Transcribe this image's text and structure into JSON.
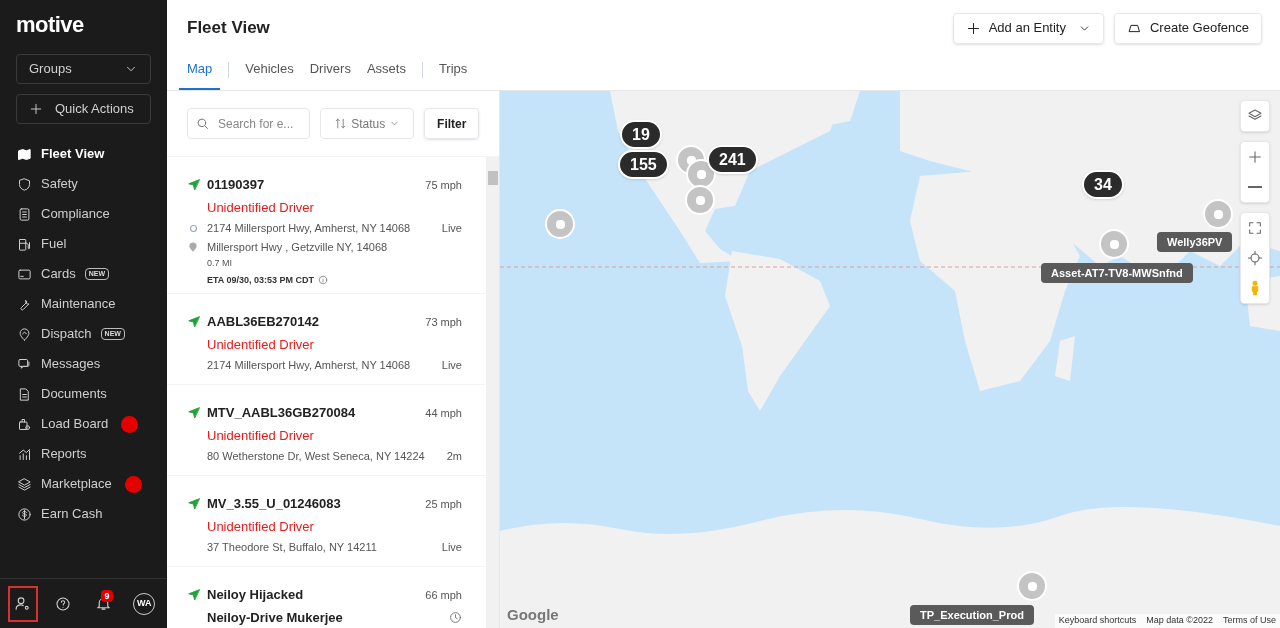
{
  "sidebar": {
    "logo": "motive",
    "groups_select": "Groups",
    "quick_actions": "Quick Actions",
    "items": [
      {
        "label": "Fleet View",
        "selected": true
      },
      {
        "label": "Safety",
        "selected": false
      },
      {
        "label": "Compliance",
        "selected": false
      },
      {
        "label": "Fuel",
        "selected": false
      },
      {
        "label": "Cards",
        "selected": false,
        "badge": "NEW"
      },
      {
        "label": "Maintenance",
        "selected": false
      },
      {
        "label": "Dispatch",
        "selected": false,
        "badge": "NEW"
      },
      {
        "label": "Messages",
        "selected": false
      },
      {
        "label": "Documents",
        "selected": false
      },
      {
        "label": "Load Board",
        "selected": false,
        "alert": true
      },
      {
        "label": "Reports",
        "selected": false
      },
      {
        "label": "Marketplace",
        "selected": false,
        "alert": true
      },
      {
        "label": "Earn Cash",
        "selected": false
      }
    ],
    "footer": [
      {
        "kind": "user-settings",
        "highlighted": true
      },
      {
        "kind": "help",
        "highlighted": false
      },
      {
        "kind": "bell",
        "highlighted": false,
        "count": "9"
      },
      {
        "kind": "avatar",
        "highlighted": false,
        "initials": "WA"
      }
    ]
  },
  "header": {
    "title": "Fleet View",
    "add_entity": "Add an Entity",
    "create_geofence": "Create Geofence",
    "tabs": [
      {
        "label": "Map",
        "selected": true
      },
      {
        "label": "Vehicles",
        "selected": false
      },
      {
        "label": "Drivers",
        "selected": false
      },
      {
        "label": "Assets",
        "selected": false
      },
      {
        "label": "Trips",
        "selected": false
      }
    ]
  },
  "list": {
    "search_placeholder": "Search for e...",
    "sort": "Status",
    "filter": "Filter",
    "vehicles": [
      {
        "name": "01190397",
        "speed": "75 mph",
        "driver": "Unidentified Driver",
        "unidentified": true,
        "address": "2174 Millersport Hwy, Amherst, NY 14068",
        "status": "Live",
        "destination": "Millersport Hwy , Getzville NY, 14068",
        "distance": "0.7 MI",
        "eta": "ETA 09/30, 03:53 PM CDT"
      },
      {
        "name": "AABL36EB270142",
        "speed": "73 mph",
        "driver": "Unidentified Driver",
        "unidentified": true,
        "address": "2174 Millersport Hwy, Amherst, NY 14068",
        "status": "Live"
      },
      {
        "name": "MTV_AABL36GB270084",
        "speed": "44 mph",
        "driver": "Unidentified Driver",
        "unidentified": true,
        "address": "80 Wetherstone Dr, West Seneca, NY 14224",
        "status": "2m"
      },
      {
        "name": "MV_3.55_U_01246083",
        "speed": "25 mph",
        "driver": "Unidentified Driver",
        "unidentified": true,
        "address": "37 Theodore St, Buffalo, NY 14211",
        "status": "Live"
      },
      {
        "name": "Neiloy Hijacked",
        "speed": "66 mph",
        "driver": "Neiloy-Drive Mukerjee",
        "unidentified": false,
        "clock": true
      }
    ]
  },
  "map": {
    "clusters": [
      "19",
      "155",
      "241",
      "34"
    ],
    "asset_labels": [
      "Asset-AT7-TV8-MWSnfnd",
      "Welly36PV",
      "TP_Execution_Prod"
    ],
    "logo": "Google",
    "attribution": [
      "Keyboard shortcuts",
      "Map data ©2022",
      "Terms of Use"
    ]
  }
}
